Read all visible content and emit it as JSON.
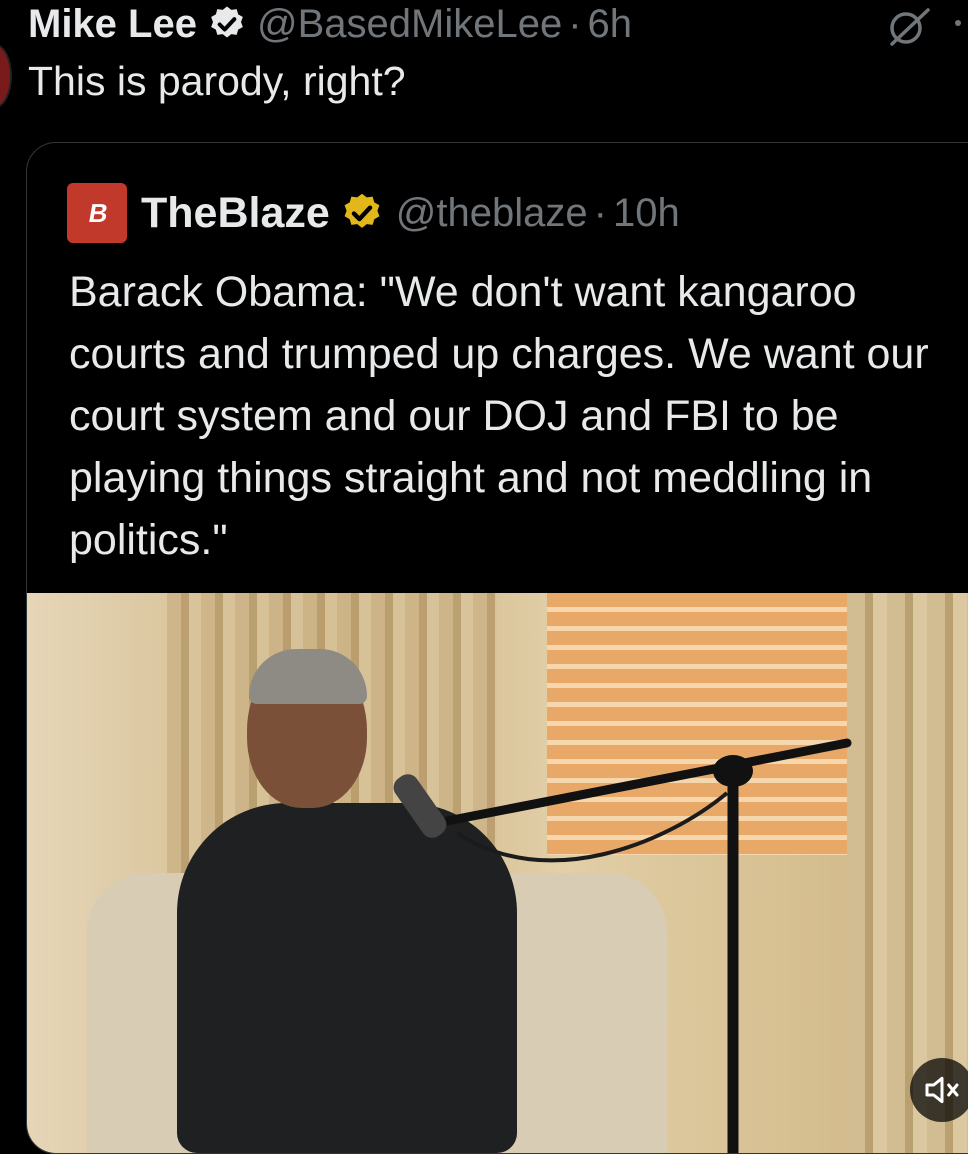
{
  "tweet": {
    "author_name": "Mike Lee",
    "handle": "@BasedMikeLee",
    "separator": "·",
    "time": "6h",
    "text": "This is parody, right?",
    "icons": [
      "verified-badge-icon",
      "grok-icon",
      "more-icon"
    ]
  },
  "quoted_tweet": {
    "avatar_text": "B",
    "author_name": "TheBlaze",
    "handle": "@theblaze",
    "separator": "·",
    "time": "10h",
    "text": "Barack Obama: \"We don't want kangaroo courts and trumped up charges. We want our court system and our DOJ and FBI to be playing things straight and not meddling in politics.\"",
    "icons": [
      "gold-verified-badge-icon",
      "video-thumbnail",
      "mute-icon"
    ]
  },
  "colors": {
    "background": "#000000",
    "primary_text": "#e7e9ea",
    "secondary_text": "#71767b",
    "verified_blue": "#1d9bf0",
    "verified_gold": "#e2b719",
    "blaze_red": "#c0392b"
  }
}
